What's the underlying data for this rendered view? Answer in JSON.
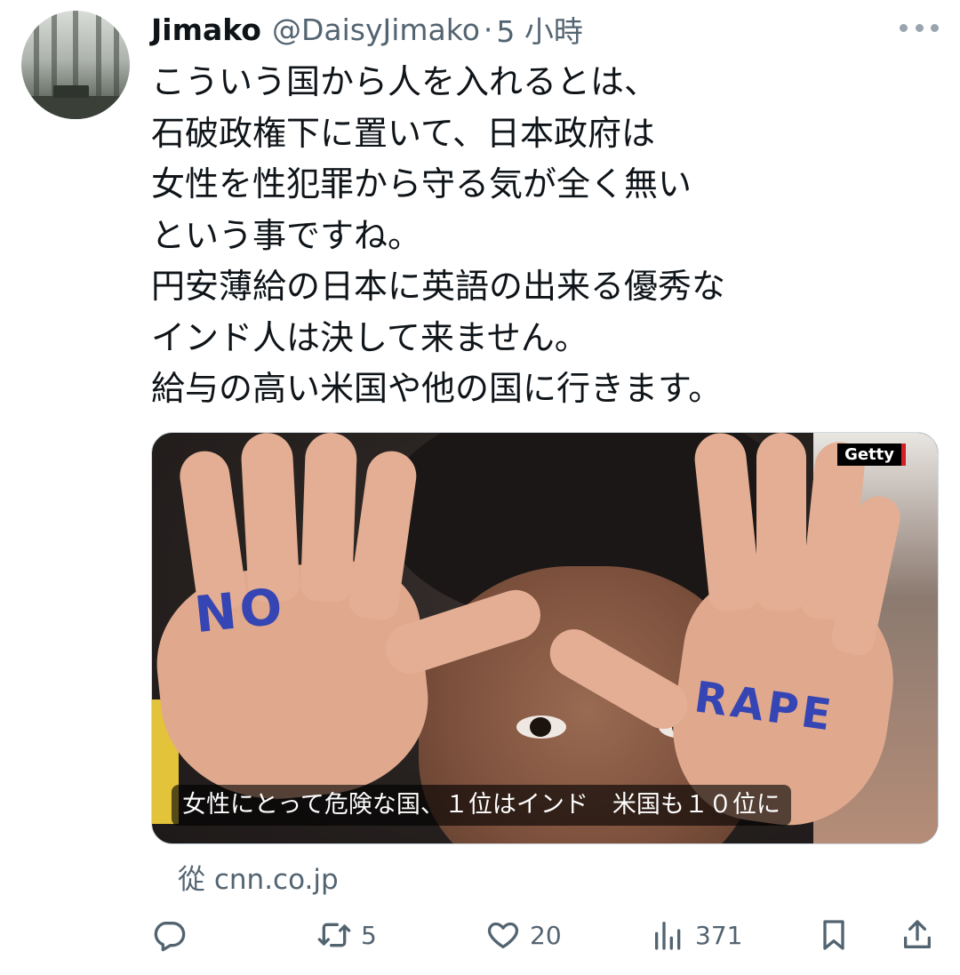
{
  "tweet": {
    "author": {
      "display_name": "Jimako",
      "handle": "@DaisyJimako",
      "separator": "·",
      "time": "5 小時"
    },
    "text_lines": [
      "こういう国から人を入れるとは、",
      "石破政権下に置いて、日本政府は",
      "女性を性犯罪から守る気が全く無い",
      "という事ですね。",
      "円安薄給の日本に英語の出来る優秀な",
      "インド人は決して来ません。",
      "給与の高い米国や他の国に行きます。"
    ],
    "card": {
      "image_text_left": "NO",
      "image_text_right": "RAPE",
      "badge": "Getty",
      "caption": "女性にとって危険な国、１位はインド　米国も１０位に",
      "source": "從 cnn.co.jp"
    },
    "actions": {
      "reply": {
        "icon": "reply-icon",
        "count": ""
      },
      "retweet": {
        "icon": "retweet-icon",
        "count": "5"
      },
      "like": {
        "icon": "heart-icon",
        "count": "20"
      },
      "views": {
        "icon": "views-icon",
        "count": "371"
      },
      "bookmark": {
        "icon": "bookmark-icon"
      },
      "share": {
        "icon": "share-icon"
      }
    }
  },
  "colors": {
    "text": "#0f1419",
    "secondary": "#536471",
    "border": "#cfd9de",
    "background": "#ffffff"
  }
}
